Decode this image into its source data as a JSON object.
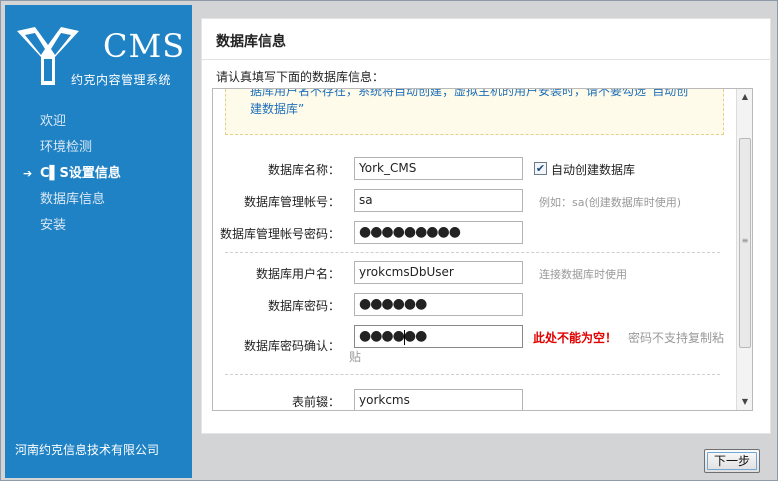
{
  "sidebar": {
    "logo_text": "CMS",
    "logo_subtitle": "约克内容管理系统",
    "nav_items": [
      {
        "label": "欢迎",
        "active": false
      },
      {
        "label": "环境检测",
        "active": false
      },
      {
        "label": "C▌S设置信息",
        "active": true
      },
      {
        "label": "数据库信息",
        "active": false
      },
      {
        "label": "安装",
        "active": false
      }
    ],
    "active_marker": "➔",
    "company": "河南约克信息技术有限公司"
  },
  "main": {
    "title": "数据库信息",
    "intro": "请认真填写下面的数据库信息：",
    "notice_lines": [
      "据库用户名不存在，系统将自动创建；虚拟主机的用户安装时，请不要勾选“自动创",
      "建数据库”"
    ],
    "form": {
      "db_name": {
        "label": "数据库名称：",
        "value": "York_CMS"
      },
      "auto_create": {
        "label": "自动创建数据库",
        "checked": true,
        "check_glyph": "✔"
      },
      "admin_account": {
        "label": "数据库管理帐号：",
        "value": "sa",
        "hint": "例如：sa(创建数据库时使用)"
      },
      "admin_password": {
        "label": "数据库管理帐号密码：",
        "value": "●●●●●●●●●"
      },
      "db_user": {
        "label": "数据库用户名：",
        "value": "yrokcmsDbUser",
        "hint": "连接数据库时使用"
      },
      "db_password": {
        "label": "数据库密码：",
        "value": "●●●●●●"
      },
      "db_password_confirm": {
        "label": "数据库密码确认：",
        "value": "●●●●●●",
        "error": "此处不能为空！",
        "hint_line1": "密码不支持复制粘",
        "hint_line2": "贴"
      },
      "table_prefix": {
        "label": "表前辍：",
        "value": "yorkcms"
      }
    },
    "scrollbar": {
      "up": "▲",
      "down": "▼",
      "grip": "≡"
    }
  },
  "footer": {
    "next_label": "下一步"
  },
  "colors": {
    "sidebar_bg": "#1f82c5",
    "notice_text": "#1f6fb8",
    "error": "#e00000",
    "hint": "#999999",
    "frame_bg": "#d2d4d6"
  }
}
